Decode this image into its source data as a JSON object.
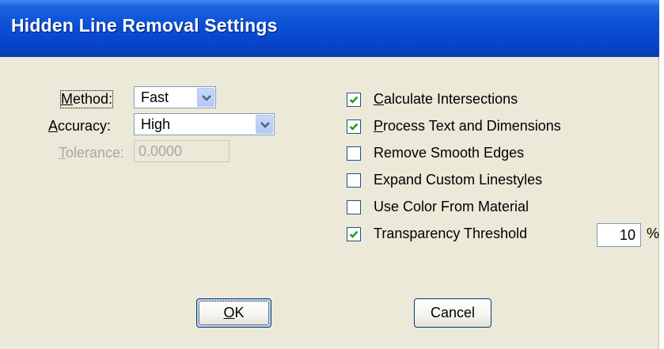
{
  "window": {
    "title": "Hidden Line Removal Settings"
  },
  "method": {
    "label_hotkey": "M",
    "label_rest": "ethod:",
    "value": "Fast"
  },
  "accuracy": {
    "label_hotkey": "A",
    "label_rest": "ccuracy:",
    "value": "High"
  },
  "tolerance": {
    "label_hotkey": "T",
    "label_rest": "olerance:",
    "value": "0.0000",
    "enabled": false
  },
  "options": [
    {
      "hotkey": "C",
      "rest": "alculate Intersections",
      "checked": true
    },
    {
      "hotkey": "P",
      "rest": "rocess Text and Dimensions",
      "checked": true
    },
    {
      "hotkey": "",
      "rest": "Remove Smooth Edges",
      "checked": false
    },
    {
      "hotkey": "",
      "rest": "Expand Custom Linestyles",
      "checked": false
    },
    {
      "hotkey": "",
      "rest": "Use Color From Material",
      "checked": false
    },
    {
      "hotkey": "",
      "rest": "Transparency Threshold",
      "checked": true
    }
  ],
  "threshold": {
    "value": "10",
    "unit": "%"
  },
  "buttons": {
    "ok_hotkey": "O",
    "ok_rest": "K",
    "cancel": "Cancel"
  },
  "colors": {
    "title_bar": "#0a4fd6",
    "dialog_bg": "#ece9d8",
    "checkmark": "#21a121",
    "disabled_text": "#a7a6aa"
  },
  "icons": {
    "dropdown": "chevron-down-icon",
    "check": "checkmark-icon"
  }
}
